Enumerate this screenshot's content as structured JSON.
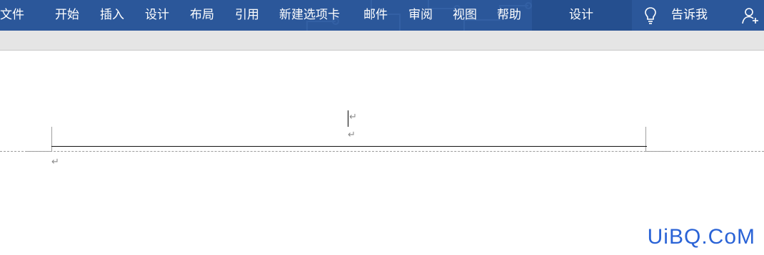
{
  "ribbon": {
    "tabs": [
      {
        "label": "文件"
      },
      {
        "label": "开始"
      },
      {
        "label": "插入"
      },
      {
        "label": "设计"
      },
      {
        "label": "布局"
      },
      {
        "label": "引用"
      },
      {
        "label": "新建选项卡"
      },
      {
        "label": "邮件"
      },
      {
        "label": "审阅"
      },
      {
        "label": "视图"
      },
      {
        "label": "帮助"
      }
    ],
    "context_tab": "设计",
    "tell_me": "告诉我",
    "colors": {
      "ribbon": "#2b579a",
      "context": "#254f8f",
      "toolbar": "#e5e5e5"
    },
    "icons": [
      "lightbulb-icon",
      "add-user-icon"
    ]
  },
  "document": {
    "paragraph_mark": "↵"
  },
  "watermark": "UiBQ.CoM"
}
